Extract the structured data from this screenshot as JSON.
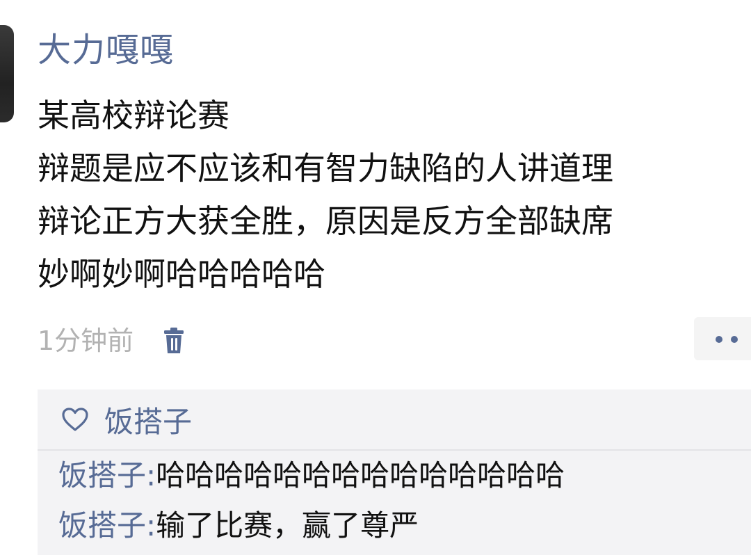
{
  "post": {
    "username": "大力嘎嘎",
    "lines": [
      "某高校辩论赛",
      "辩题是应不应该和有智力缺陷的人讲道理",
      "辩论正方大获全胜，原因是反方全部缺席",
      "妙啊妙啊哈哈哈哈哈"
    ],
    "time": "1分钟前",
    "delete_icon": "trash-icon",
    "more_icon": "more-dots-icon"
  },
  "likes": {
    "icon": "heart-outline-icon",
    "names": "饭搭子"
  },
  "comments": [
    {
      "author": "饭搭子",
      "separator": ":",
      "text": "哈哈哈哈哈哈哈哈哈哈哈哈哈哈"
    },
    {
      "author": "饭搭子",
      "separator": ":",
      "text": "输了比赛，赢了尊严"
    }
  ],
  "colors": {
    "link": "#576b95",
    "text": "#111111",
    "muted": "#b2b2b2",
    "comment_bg": "#f3f3f5"
  }
}
